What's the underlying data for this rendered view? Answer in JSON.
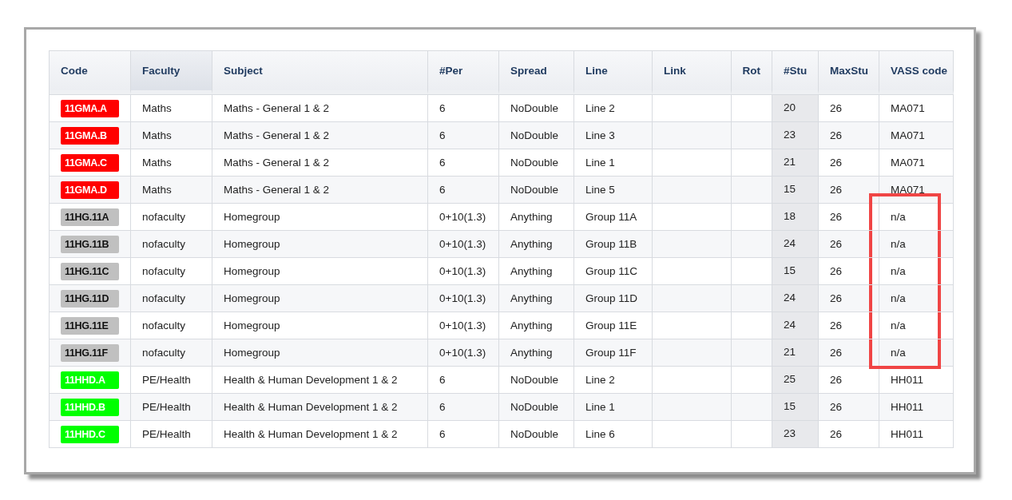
{
  "table": {
    "columns": [
      {
        "label": "Code",
        "selected": false
      },
      {
        "label": "Faculty",
        "selected": true
      },
      {
        "label": "Subject",
        "selected": false
      },
      {
        "label": "#Per",
        "selected": false
      },
      {
        "label": "Spread",
        "selected": false
      },
      {
        "label": "Line",
        "selected": false
      },
      {
        "label": "Link",
        "selected": false
      },
      {
        "label": "Rot",
        "selected": false
      },
      {
        "label": "#Stu",
        "selected": false
      },
      {
        "label": "MaxStu",
        "selected": false
      },
      {
        "label": "VASS code",
        "selected": false
      }
    ],
    "rows": [
      {
        "code": "11GMA.A",
        "color": "#ff0000",
        "faculty": "Maths",
        "subject": "Maths - General 1 & 2",
        "per": "6",
        "spread": "NoDouble",
        "line": "Line 2",
        "stu": "20",
        "max": "26",
        "vass": "MA071",
        "highlighted": false
      },
      {
        "code": "11GMA.B",
        "color": "#ff0000",
        "faculty": "Maths",
        "subject": "Maths - General 1 & 2",
        "per": "6",
        "spread": "NoDouble",
        "line": "Line 3",
        "stu": "23",
        "max": "26",
        "vass": "MA071",
        "highlighted": false
      },
      {
        "code": "11GMA.C",
        "color": "#ff0000",
        "faculty": "Maths",
        "subject": "Maths - General 1 & 2",
        "per": "6",
        "spread": "NoDouble",
        "line": "Line 1",
        "stu": "21",
        "max": "26",
        "vass": "MA071",
        "highlighted": false
      },
      {
        "code": "11GMA.D",
        "color": "#ff0000",
        "faculty": "Maths",
        "subject": "Maths - General 1 & 2",
        "per": "6",
        "spread": "NoDouble",
        "line": "Line 5",
        "stu": "15",
        "max": "26",
        "vass": "MA071",
        "highlighted": false
      },
      {
        "code": "11HG.11A",
        "color": "#c0c0c0",
        "faculty": "nofaculty",
        "subject": "Homegroup",
        "per": "0+10(1.3)",
        "spread": "Anything",
        "line": "Group 11A",
        "stu": "18",
        "max": "26",
        "vass": "n/a",
        "highlighted": true
      },
      {
        "code": "11HG.11B",
        "color": "#c0c0c0",
        "faculty": "nofaculty",
        "subject": "Homegroup",
        "per": "0+10(1.3)",
        "spread": "Anything",
        "line": "Group 11B",
        "stu": "24",
        "max": "26",
        "vass": "n/a",
        "highlighted": true
      },
      {
        "code": "11HG.11C",
        "color": "#c0c0c0",
        "faculty": "nofaculty",
        "subject": "Homegroup",
        "per": "0+10(1.3)",
        "spread": "Anything",
        "line": "Group 11C",
        "stu": "15",
        "max": "26",
        "vass": "n/a",
        "highlighted": true
      },
      {
        "code": "11HG.11D",
        "color": "#c0c0c0",
        "faculty": "nofaculty",
        "subject": "Homegroup",
        "per": "0+10(1.3)",
        "spread": "Anything",
        "line": "Group 11D",
        "stu": "24",
        "max": "26",
        "vass": "n/a",
        "highlighted": true
      },
      {
        "code": "11HG.11E",
        "color": "#c0c0c0",
        "faculty": "nofaculty",
        "subject": "Homegroup",
        "per": "0+10(1.3)",
        "spread": "Anything",
        "line": "Group 11E",
        "stu": "24",
        "max": "26",
        "vass": "n/a",
        "highlighted": true
      },
      {
        "code": "11HG.11F",
        "color": "#c0c0c0",
        "faculty": "nofaculty",
        "subject": "Homegroup",
        "per": "0+10(1.3)",
        "spread": "Anything",
        "line": "Group 11F",
        "stu": "21",
        "max": "26",
        "vass": "n/a",
        "highlighted": true
      },
      {
        "code": "11HHD.A",
        "color": "#00ff00",
        "faculty": "PE/Health",
        "subject": "Health & Human Development 1 & 2",
        "per": "6",
        "spread": "NoDouble",
        "line": "Line 2",
        "stu": "25",
        "max": "26",
        "vass": "HH011",
        "highlighted": false
      },
      {
        "code": "11HHD.B",
        "color": "#00ff00",
        "faculty": "PE/Health",
        "subject": "Health & Human Development 1 & 2",
        "per": "6",
        "spread": "NoDouble",
        "line": "Line 1",
        "stu": "15",
        "max": "26",
        "vass": "HH011",
        "highlighted": false
      },
      {
        "code": "11HHD.C",
        "color": "#00ff00",
        "faculty": "PE/Health",
        "subject": "Health & Human Development 1 & 2",
        "per": "6",
        "spread": "NoDouble",
        "line": "Line 6",
        "stu": "23",
        "max": "26",
        "vass": "HH011",
        "highlighted": false
      }
    ]
  }
}
